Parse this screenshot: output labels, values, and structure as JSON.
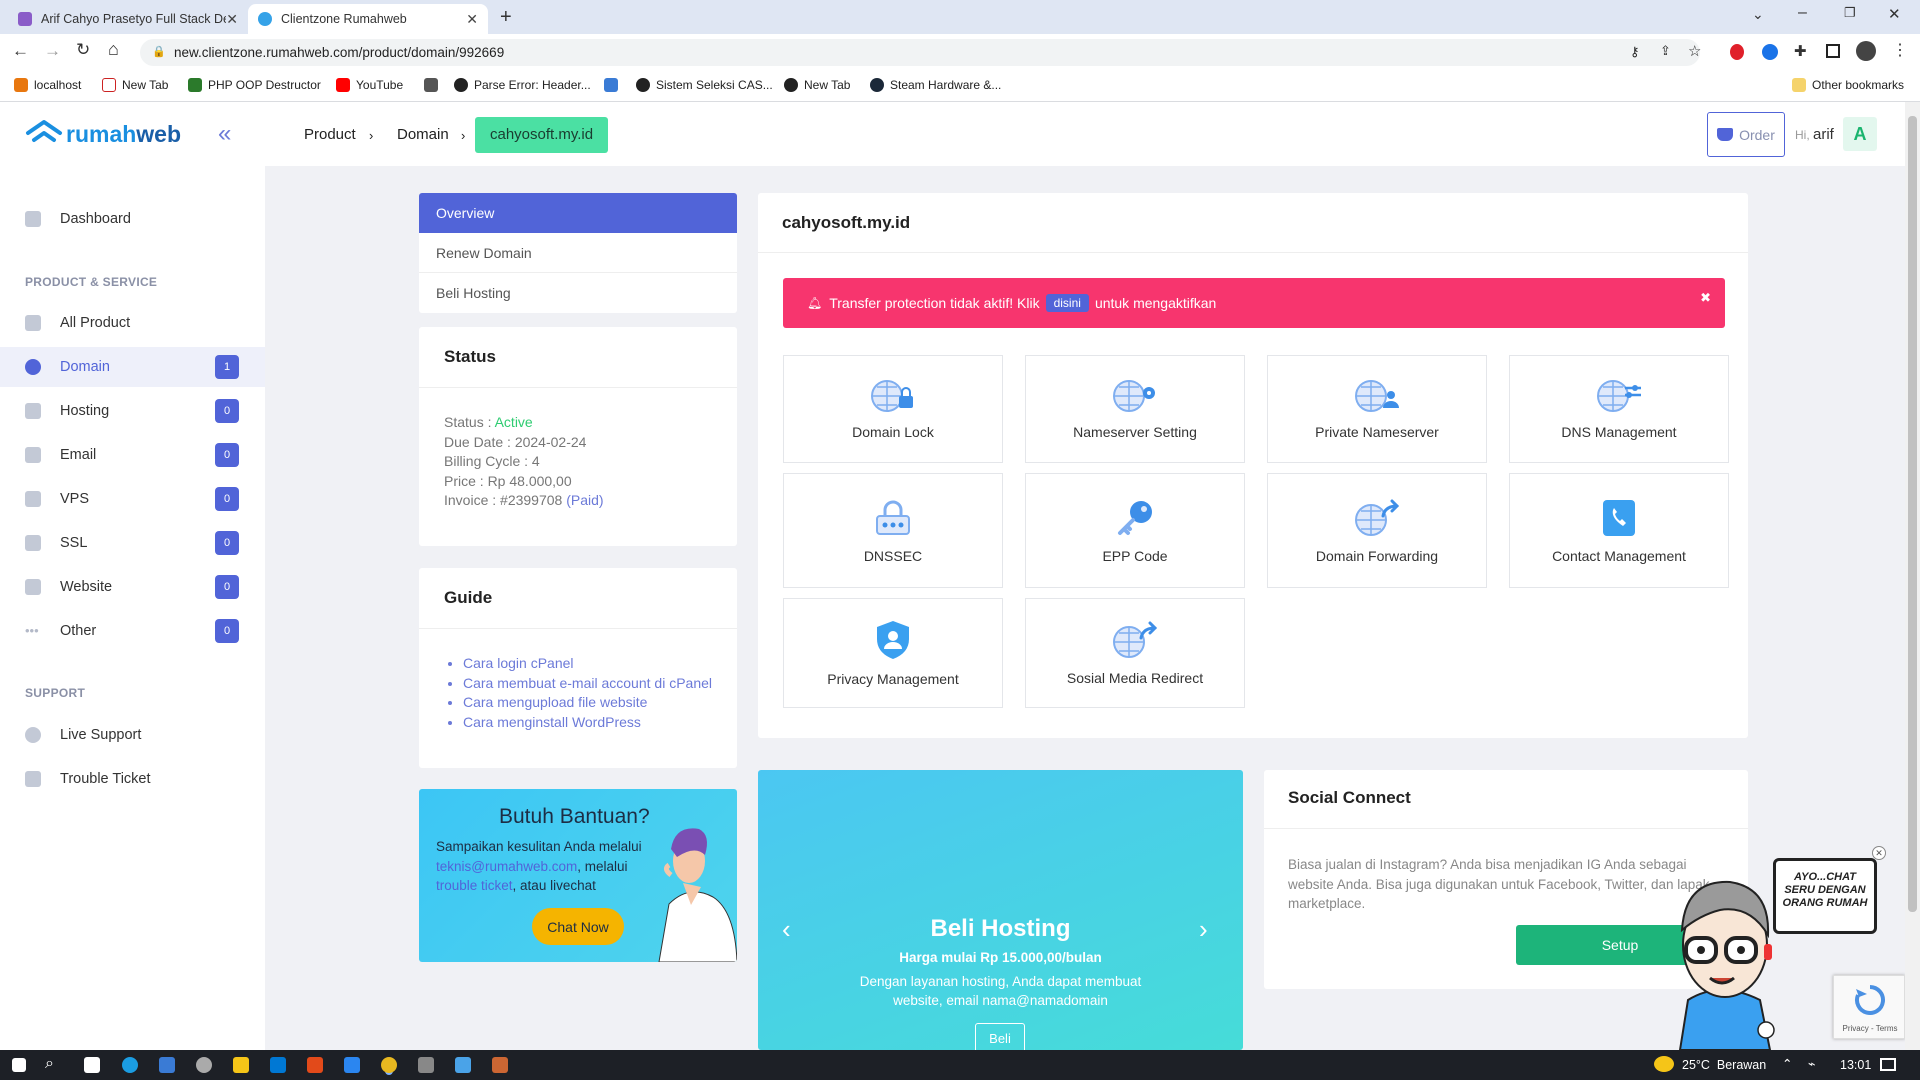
{
  "browser": {
    "tabs": [
      {
        "title": "Arif Cahyo Prasetyo Full Stack De",
        "active": false
      },
      {
        "title": "Clientzone Rumahweb",
        "active": true
      }
    ],
    "url": "new.clientzone.rumahweb.com/product/domain/992669",
    "bookmarks": [
      "localhost",
      "New Tab",
      "PHP OOP Destructor",
      "YouTube",
      "Parse Error: Header...",
      "Sistem Seleksi CAS...",
      "New Tab",
      "Steam Hardware &...",
      "Other bookmarks"
    ]
  },
  "brand": {
    "prefix": "rumah",
    "suffix": "web",
    "color": "#1a8fe0"
  },
  "sidebar": {
    "dashboard": "Dashboard",
    "section_products": "PRODUCT & SERVICE",
    "items": [
      {
        "label": "All Product",
        "count": null
      },
      {
        "label": "Domain",
        "count": "1"
      },
      {
        "label": "Hosting",
        "count": "0"
      },
      {
        "label": "Email",
        "count": "0"
      },
      {
        "label": "VPS",
        "count": "0"
      },
      {
        "label": "SSL",
        "count": "0"
      },
      {
        "label": "Website",
        "count": "0"
      },
      {
        "label": "Other",
        "count": "0"
      }
    ],
    "section_support": "SUPPORT",
    "support_items": [
      "Live Support",
      "Trouble Ticket"
    ]
  },
  "topbar": {
    "breadcrumb": [
      "Product",
      "Domain",
      "cahyosoft.my.id"
    ],
    "order_label": "Order",
    "greeting": "Hi,",
    "user": "arif",
    "avatar": "A"
  },
  "menu": [
    "Overview",
    "Renew Domain",
    "Beli Hosting"
  ],
  "status_card": {
    "title": "Status",
    "status_label": "Status : ",
    "status_value": "Active",
    "due_date": "Due Date : 2024-02-24",
    "billing_cycle": "Billing Cycle : 4",
    "price": "Price : Rp 48.000,00",
    "invoice_label": "Invoice : #2399708 ",
    "invoice_state": "(Paid)"
  },
  "guide_card": {
    "title": "Guide",
    "links": [
      "Cara login cPanel",
      "Cara membuat e-mail account di cPanel",
      "Cara mengupload file website",
      "Cara menginstall WordPress"
    ]
  },
  "help_banner": {
    "title": "Butuh Bantuan?",
    "text_1": "Sampaikan kesulitan Anda melalui",
    "email": "teknis@rumahweb.com",
    "text_2": ", melalui",
    "ticket": "trouble ticket",
    "text_3": ", atau livechat",
    "button": "Chat Now"
  },
  "domain_panel": {
    "domain": "cahyosoft.my.id",
    "alert_text_1": "Transfer protection tidak aktif! Klik",
    "alert_link": "disini",
    "alert_text_2": "untuk mengaktifkan",
    "alert_color": "#f7356e",
    "services": [
      "Domain Lock",
      "Nameserver Setting",
      "Private Nameserver",
      "DNS Management",
      "DNSSEC",
      "EPP Code",
      "Domain Forwarding",
      "Contact Management",
      "Privacy Management",
      "Sosial Media Redirect"
    ]
  },
  "promo": {
    "title": "Beli Hosting",
    "subtitle": "Harga mulai Rp 15.000,00/bulan",
    "text": "Dengan layanan hosting, Anda dapat membuat website, email nama@namadomain",
    "button": "Beli"
  },
  "social": {
    "title": "Social Connect",
    "text": "Biasa jualan di Instagram? Anda bisa menjadikan IG Anda sebagai website Anda. Bisa juga digunakan untuk Facebook, Twitter, dan lapak marketplace.",
    "button": "Setup"
  },
  "chat_bubble": [
    "AYO...CHAT",
    "SERU DENGAN",
    "ORANG RUMAH"
  ],
  "recaptcha": "Privacy - Terms",
  "taskbar": {
    "weather": "25°C  Berawan",
    "time": "13:01"
  },
  "colors": {
    "primary": "#5164d8",
    "active_green": "#2ecc71",
    "setup_button": "#1db47a",
    "chat_button": "#f5b400"
  }
}
